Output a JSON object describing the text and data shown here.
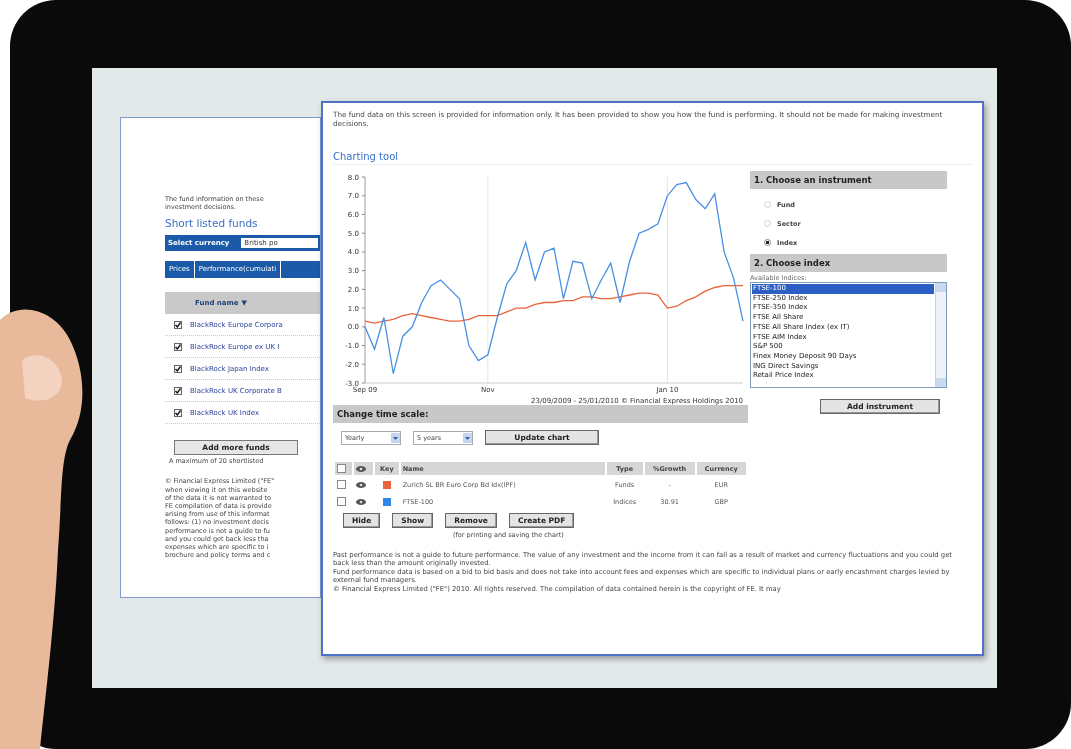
{
  "back_window": {
    "intro_lines": [
      "The fund information on these",
      "investment decisions."
    ],
    "heading": "Short listed funds",
    "currency": {
      "label": "Select currency",
      "value": "British po"
    },
    "tabs": [
      {
        "label": "Prices",
        "selected": false
      },
      {
        "label": "Performance(cumulati",
        "selected": false
      }
    ],
    "fund_column": {
      "label": "Fund name",
      "sort": "▼"
    },
    "funds": [
      {
        "name": "BlackRock Europe Corpora",
        "checked": true
      },
      {
        "name": "BlackRock Europe ex UK I",
        "checked": true
      },
      {
        "name": "BlackRock Japan Index",
        "checked": true
      },
      {
        "name": "BlackRock UK Corporate B",
        "checked": true
      },
      {
        "name": "BlackRock UK Index",
        "checked": true
      }
    ],
    "add_button": "Add more funds",
    "max_note": "A maximum of 20 shortlisted",
    "disclaimer_lines": [
      "© Financial Express Limited (\"FE\"",
      "when viewing it on this website",
      "of the data it is not warranted to",
      "FE compilation of data is provide",
      "arising from use of this informat",
      "follows: (1) no investment decis",
      "performance is not a guide to fu",
      "and you could get back less tha",
      "expenses which are specific to i",
      "brochure and policy terms and c"
    ]
  },
  "chart_window": {
    "notice": "The fund data on this screen is provided for information only. It has been provided to show you how the fund is performing. It should not be made for making investment decisions.",
    "title": "Charting tool",
    "chart_data": {
      "type": "line",
      "categories": [
        "Sep 09",
        null,
        null,
        null,
        null,
        null,
        null,
        null,
        null,
        null,
        null,
        null,
        null,
        "Nov",
        null,
        null,
        null,
        null,
        null,
        null,
        null,
        null,
        null,
        null,
        null,
        null,
        null,
        null,
        null,
        null,
        null,
        null,
        "Jan 10",
        null,
        null,
        null,
        null,
        null,
        null,
        null,
        null
      ],
      "series": [
        {
          "color": "#e8643c",
          "values": [
            0.3,
            0.2,
            0.3,
            0.4,
            0.6,
            0.7,
            0.6,
            0.5,
            0.4,
            0.3,
            0.3,
            0.4,
            0.6,
            0.6,
            0.6,
            0.8,
            1.0,
            1.0,
            1.2,
            1.3,
            1.3,
            1.4,
            1.4,
            1.6,
            1.6,
            1.5,
            1.5,
            1.6,
            1.7,
            1.8,
            1.8,
            1.7,
            1.0,
            1.1,
            1.4,
            1.6,
            1.9,
            2.1,
            2.2,
            2.2,
            2.2
          ]
        },
        {
          "color": "#4a8fe0",
          "values": [
            0.0,
            -1.2,
            0.5,
            -2.5,
            -0.5,
            0.0,
            1.3,
            2.2,
            2.5,
            2.0,
            1.5,
            -1.0,
            -1.8,
            -1.5,
            0.5,
            2.3,
            3.0,
            4.5,
            2.5,
            4.0,
            4.2,
            1.5,
            3.5,
            3.4,
            1.5,
            2.5,
            3.4,
            1.3,
            3.5,
            5.0,
            5.2,
            5.5,
            7.0,
            7.6,
            7.7,
            6.8,
            6.3,
            7.1,
            4.0,
            2.6,
            0.3
          ]
        }
      ],
      "ylim": [
        -3,
        8
      ],
      "yticks": [
        {
          "value": 8,
          "label": "8.0"
        },
        {
          "value": 7,
          "label": "7.0"
        },
        {
          "value": 6,
          "label": "6.0"
        },
        {
          "value": 5,
          "label": "5.0"
        },
        {
          "value": 4,
          "label": "4.0"
        },
        {
          "value": 3,
          "label": "3.0"
        },
        {
          "value": 2,
          "label": "2.0"
        },
        {
          "value": 1,
          "label": "1.0"
        },
        {
          "value": 0,
          "label": "0.0"
        },
        {
          "value": -1,
          "label": "-1.0"
        },
        {
          "value": -2,
          "label": "-2.0"
        },
        {
          "value": -3,
          "label": "-3.0"
        }
      ]
    },
    "chart_caption": "23/09/2009 - 25/01/2010 © Financial Express Holdings 2010",
    "instrument": {
      "heading": "1. Choose an instrument",
      "options": [
        {
          "label": "Fund",
          "selected": false
        },
        {
          "label": "Sector",
          "selected": false
        },
        {
          "label": "Index",
          "selected": true
        }
      ]
    },
    "index": {
      "heading": "2. Choose index",
      "list_label": "Available Indices:",
      "items": [
        {
          "label": "FTSE-100",
          "selected": true
        },
        {
          "label": "FTSE-250 Index",
          "selected": false
        },
        {
          "label": "FTSE-350 Index",
          "selected": false
        },
        {
          "label": "FTSE All Share",
          "selected": false
        },
        {
          "label": "FTSE All Share Index (ex IT)",
          "selected": false
        },
        {
          "label": "FTSE AIM Index",
          "selected": false
        },
        {
          "label": "S&P 500",
          "selected": false
        },
        {
          "label": "Finex Money Deposit 90 Days",
          "selected": false
        },
        {
          "label": "ING Direct Savings",
          "selected": false
        },
        {
          "label": "Retail Price Index",
          "selected": false
        }
      ],
      "button": "Add instrument"
    },
    "time_scale": {
      "heading": "Change time scale:",
      "period": "Yearly",
      "span": "5 years",
      "button": "Update chart"
    },
    "holdings": {
      "select_all_checked": false,
      "columns": [
        "Key",
        "Name",
        "Type",
        "%Growth",
        "Currency"
      ],
      "rows": [
        {
          "checked": false,
          "color": "#e8643c",
          "name": "Zurich SL BR Euro Corp Bd Idx(IPF)",
          "type": "Funds",
          "growth": "-",
          "currency": "EUR"
        },
        {
          "checked": false,
          "color": "#2f86e8",
          "name": "FTSE-100",
          "type": "Indices",
          "growth": "30.91",
          "currency": "GBP"
        }
      ]
    },
    "actions": [
      "Hide",
      "Show",
      "Remove",
      "Create PDF"
    ],
    "actions_note": "(for printing and saving the chart)",
    "footer_paragraphs": [
      "Past performance is not a guide to future performance. The value of any investment and the income from it can fall as a result of market and currency fluctuations and you could get back less than the amount originally invested.",
      "Fund performance data is based on a bid to bid basis and does not take into account fees and expenses which are specific to individual plans or early encashment charges levied by external fund managers.",
      "© Financial Express Limited (\"FE\") 2010. All rights reserved. The compilation of data contained herein is the copyright of FE. It may"
    ]
  }
}
